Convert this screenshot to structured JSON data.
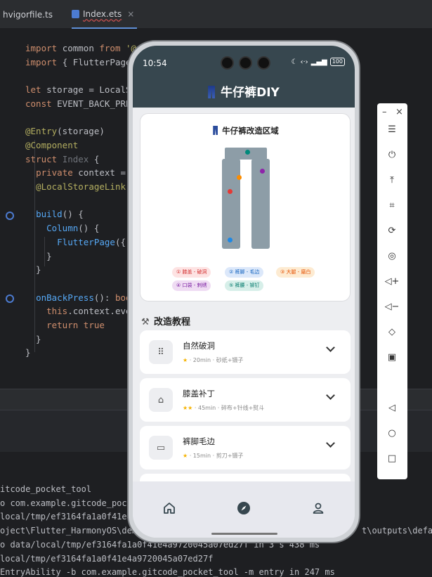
{
  "ide": {
    "tabs": [
      {
        "label": "hvigorfile.ts"
      },
      {
        "label": "Index.ets",
        "close": "×"
      }
    ],
    "code_lines": [
      {
        "segments": [
          {
            "c": "kw",
            "t": "import "
          },
          {
            "c": "",
            "t": "common "
          },
          {
            "c": "kw",
            "t": "from "
          },
          {
            "c": "an",
            "t": "'@o"
          }
        ]
      },
      {
        "segments": [
          {
            "c": "kw",
            "t": "import "
          },
          {
            "c": "",
            "t": "{ FlutterPage"
          }
        ]
      },
      {
        "segments": []
      },
      {
        "segments": [
          {
            "c": "kw",
            "t": "let "
          },
          {
            "c": "",
            "t": "storage = LocalS"
          }
        ]
      },
      {
        "segments": [
          {
            "c": "kw",
            "t": "const "
          },
          {
            "c": "",
            "t": "EVENT_BACK_PRE"
          }
        ]
      },
      {
        "segments": []
      },
      {
        "segments": [
          {
            "c": "an",
            "t": "@Entry"
          },
          {
            "c": "",
            "t": "(storage)"
          }
        ]
      },
      {
        "segments": [
          {
            "c": "an",
            "t": "@Component"
          }
        ]
      },
      {
        "segments": [
          {
            "c": "kw",
            "t": "struct "
          },
          {
            "c": "ty",
            "t": "Index "
          },
          {
            "c": "",
            "t": "{"
          }
        ]
      },
      {
        "segments": [
          {
            "c": "",
            "t": "  "
          },
          {
            "c": "kw",
            "t": "private "
          },
          {
            "c": "",
            "t": "context = ."
          }
        ]
      },
      {
        "segments": [
          {
            "c": "",
            "t": "  "
          },
          {
            "c": "an",
            "t": "@LocalStorageLink"
          },
          {
            "c": "",
            "t": "("
          }
        ]
      },
      {
        "segments": []
      },
      {
        "segments": [
          {
            "c": "",
            "t": "  "
          },
          {
            "c": "fn",
            "t": "build"
          },
          {
            "c": "",
            "t": "() {"
          }
        ]
      },
      {
        "segments": [
          {
            "c": "",
            "t": "    "
          },
          {
            "c": "fn",
            "t": "Column"
          },
          {
            "c": "",
            "t": "() {"
          }
        ]
      },
      {
        "segments": [
          {
            "c": "",
            "t": "      "
          },
          {
            "c": "fn",
            "t": "FlutterPage"
          },
          {
            "c": "",
            "t": "({"
          }
        ]
      },
      {
        "segments": [
          {
            "c": "",
            "t": "    }"
          }
        ]
      },
      {
        "segments": [
          {
            "c": "",
            "t": "  }"
          }
        ]
      },
      {
        "segments": []
      },
      {
        "segments": [
          {
            "c": "",
            "t": "  "
          },
          {
            "c": "fn",
            "t": "onBackPress"
          },
          {
            "c": "",
            "t": "(): "
          },
          {
            "c": "kw",
            "t": "boo"
          }
        ]
      },
      {
        "segments": [
          {
            "c": "",
            "t": "    "
          },
          {
            "c": "kw",
            "t": "this"
          },
          {
            "c": "",
            "t": ".context.eve"
          }
        ]
      },
      {
        "segments": [
          {
            "c": "",
            "t": "    "
          },
          {
            "c": "kw",
            "t": "return true"
          }
        ]
      },
      {
        "segments": [
          {
            "c": "",
            "t": "  }"
          }
        ]
      },
      {
        "segments": [
          {
            "c": "",
            "t": "}"
          }
        ]
      }
    ],
    "console_lines": [
      "itcode_pocket_tool",
      "o com.example.gitcode_pock",
      "local/tmp/ef3164fa1a0f41e4a",
      "oject\\Flutter_HarmonyOS\\demo",
      "o data/local/tmp/ef3164fa1a0f41e4a9720045a07ed27f in 3 s 438 ms",
      "local/tmp/ef3164fa1a0f41e4a9720045a07ed27f",
      "EntryAbility -b com.example.gitcode_pocket_tool -m entry in 247 ms"
    ],
    "console_overflow": [
      {
        "text": "t\\outputs\\defau",
        "row": 3
      }
    ]
  },
  "emulator": {
    "minimize": "–",
    "close": "×",
    "buttons": [
      "menu-icon",
      "power-icon",
      "upload-icon",
      "crop-icon",
      "rotate-icon",
      "screenshot-icon",
      "volume-up-icon",
      "volume-down-icon",
      "fold-icon",
      "foldscreen-icon",
      "back-icon",
      "home-icon",
      "recents-icon"
    ]
  },
  "phone": {
    "status_time": "10:54",
    "battery": "100",
    "app_title": "牛仔裤DIY",
    "area_title": "牛仔裤改造区域",
    "chips": [
      {
        "label": "① 膝盖 - 破洞",
        "bg": "#fde3e3",
        "fg": "#d32f2f"
      },
      {
        "label": "② 裤脚 - 毛边",
        "bg": "#dce8fa",
        "fg": "#1565c0"
      },
      {
        "label": "③ 大腿 - 磨白",
        "bg": "#fdebd2",
        "fg": "#e65100"
      },
      {
        "label": "④ 口袋 - 刺绣",
        "bg": "#efdcf3",
        "fg": "#7b1fa2"
      },
      {
        "label": "⑤ 裤腰 - 铆钉",
        "bg": "#d7efe9",
        "fg": "#00796b"
      }
    ],
    "dots": [
      {
        "color": "#e53935"
      },
      {
        "color": "#1e88e5"
      },
      {
        "color": "#fb8c00"
      },
      {
        "color": "#8e24aa"
      },
      {
        "color": "#00897b"
      }
    ],
    "section_title": "改造教程",
    "tutorials": [
      {
        "name": "自然破洞",
        "stars": "★",
        "meta": " · 20min · 砂纸+镊子",
        "icon": "grid-dots-icon"
      },
      {
        "name": "膝盖补丁",
        "stars": "★★",
        "meta": " · 45min · 碎布+针线+熨斗",
        "icon": "hanger-icon"
      },
      {
        "name": "裤脚毛边",
        "stars": "★",
        "meta": " · 15min · 剪刀+镊子",
        "icon": "ruler-icon"
      }
    ],
    "nav": [
      "home-icon",
      "compass-icon",
      "person-icon"
    ],
    "accent": "#37474f"
  }
}
